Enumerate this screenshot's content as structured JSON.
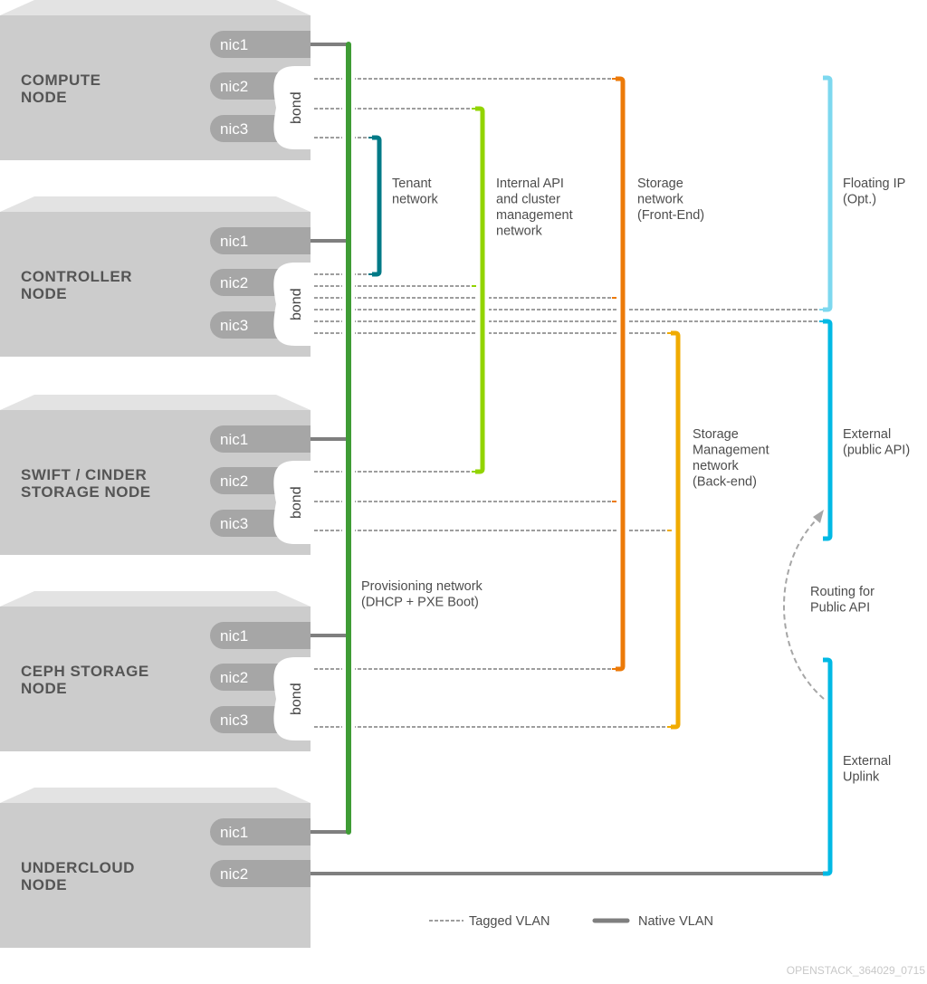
{
  "nodes": [
    {
      "name": [
        "COMPUTE",
        "NODE"
      ],
      "nics": [
        "nic1",
        "nic2",
        "nic3"
      ],
      "bond": "bond"
    },
    {
      "name": [
        "CONTROLLER",
        "NODE"
      ],
      "nics": [
        "nic1",
        "nic2",
        "nic3"
      ],
      "bond": "bond"
    },
    {
      "name": [
        "SWIFT / CINDER",
        "STORAGE NODE"
      ],
      "nics": [
        "nic1",
        "nic2",
        "nic3"
      ],
      "bond": "bond"
    },
    {
      "name": [
        "CEPH STORAGE",
        "NODE"
      ],
      "nics": [
        "nic1",
        "nic2",
        "nic3"
      ],
      "bond": "bond"
    },
    {
      "name": [
        "UNDERCLOUD",
        "NODE"
      ],
      "nics": [
        "nic1",
        "nic2"
      ]
    }
  ],
  "networks": {
    "provisioning": {
      "label": [
        "Provisioning network",
        "(DHCP + PXE Boot)"
      ],
      "color": "#3f9c35"
    },
    "tenant": {
      "label": [
        "Tenant",
        "network"
      ],
      "color": "#007a87"
    },
    "internal_api": {
      "label": [
        "Internal API",
        "and cluster",
        "management",
        "network"
      ],
      "color": "#92d400"
    },
    "storage": {
      "label": [
        "Storage",
        "network",
        "(Front-End)"
      ],
      "color": "#ec7a08"
    },
    "storage_mgmt": {
      "label": [
        "Storage",
        "Management",
        "network",
        "(Back-end)"
      ],
      "color": "#f0ab00"
    },
    "floating_ip": {
      "label": [
        "Floating IP",
        "(Opt.)"
      ],
      "color": "#7dd8ef"
    },
    "external": {
      "label": [
        "External",
        "(public API)"
      ],
      "color": "#00b9e4"
    },
    "external_uplink": {
      "label": [
        "External",
        "Uplink"
      ],
      "color": "#00b9e4"
    }
  },
  "routing_label": [
    "Routing for",
    "Public API"
  ],
  "legend": {
    "tagged": "Tagged VLAN",
    "native": "Native VLAN"
  },
  "footer": "OPENSTACK_364029_0715",
  "colors": {
    "node_body": "#cccccc",
    "node_top": "#e3e3e3",
    "nic": "#a6a6a6",
    "link_gray": "#7f7f7f"
  }
}
